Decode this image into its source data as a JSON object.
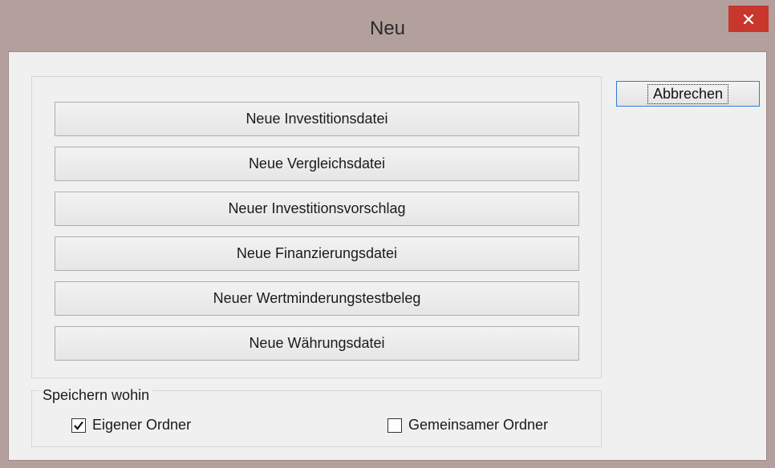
{
  "window": {
    "title": "Neu",
    "accent": "#c8362c"
  },
  "buttons": [
    {
      "label": "Neue Investitionsdatei"
    },
    {
      "label": "Neue Vergleichsdatei"
    },
    {
      "label": "Neuer Investitionsvorschlag"
    },
    {
      "label": "Neue Finanzierungsdatei"
    },
    {
      "label": "Neuer Wertminderungstestbeleg"
    },
    {
      "label": "Neue Währungsdatei"
    }
  ],
  "cancel": {
    "label": "Abbrechen"
  },
  "save_group": {
    "label": "Speichern wohin",
    "options": [
      {
        "label": "Eigener Ordner",
        "checked": true
      },
      {
        "label": "Gemeinsamer Ordner",
        "checked": false
      }
    ]
  }
}
